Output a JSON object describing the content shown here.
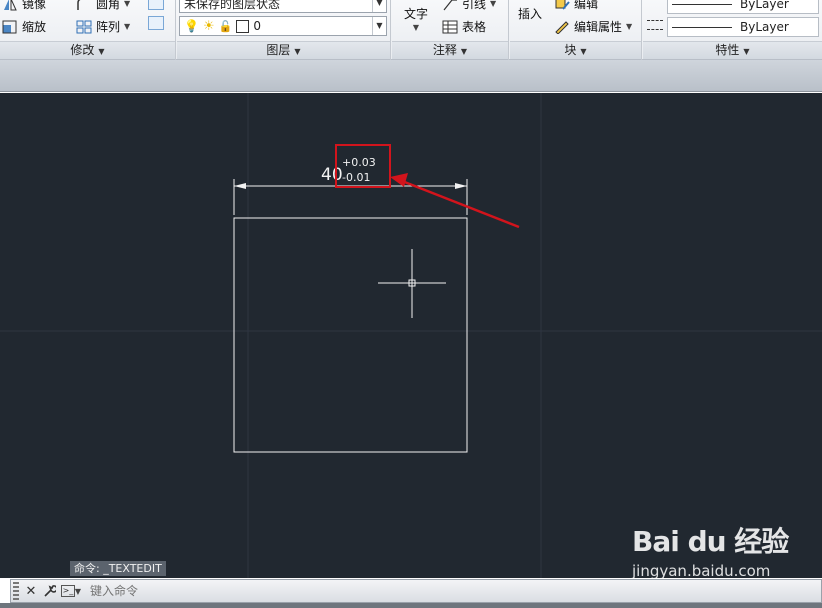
{
  "ribbon": {
    "modify": {
      "items": [
        "镜像",
        "圆角",
        "缩放",
        "阵列"
      ],
      "title": "修改"
    },
    "layers": {
      "layer_state": "未保存的图层状态",
      "current_layer": "0",
      "title": "图层"
    },
    "annotation": {
      "text_label": "文字",
      "leader_label": "引线",
      "table_label": "表格",
      "title": "注释"
    },
    "block": {
      "insert_label": "插入",
      "edit_label": "编辑",
      "edit_attr_label": "编辑属性",
      "title": "块"
    },
    "properties": {
      "lineweight": "ByLayer",
      "linetype": "ByLayer",
      "title": "特性"
    }
  },
  "drawing": {
    "dimension_value": "40",
    "tolerance_upper": "+0.03",
    "tolerance_lower": "-0.01",
    "highlight_color": "#d2141c",
    "canvas_bg": "#212830"
  },
  "command": {
    "history": "命令: _TEXTEDIT",
    "placeholder": "键入命令"
  },
  "watermark": {
    "brand": "Bai du 经验",
    "url": "jingyan.baidu.com"
  },
  "icons": [
    "mirror-icon",
    "fillet-icon",
    "scale-icon",
    "array-icon",
    "bulb-icon",
    "sun-icon",
    "lock-icon",
    "table-icon",
    "close-icon",
    "wrench-icon",
    "prompt-icon"
  ]
}
